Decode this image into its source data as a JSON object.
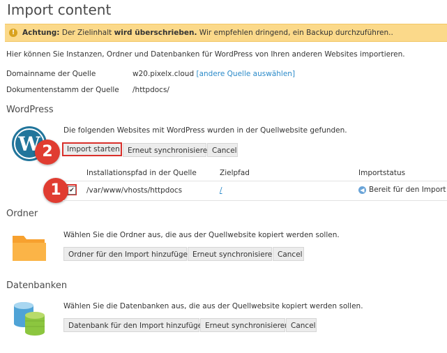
{
  "page": {
    "title": "Import content"
  },
  "warning": {
    "prefix": "Achtung:",
    "text_before": " Der Zielinhalt ",
    "emphasis": "wird überschrieben.",
    "text_after": " Wir empfehlen dringend, ein Backup durchzuführen.."
  },
  "intro": "Hier können Sie Instanzen, Ordner und Datenbanken für WordPress von Ihren anderen Websites importieren.",
  "source": {
    "domain_label": "Domainname der Quelle",
    "domain_value": "w20.pixelx.cloud",
    "change_link": "[andere Quelle auswählen]",
    "docroot_label": "Dokumentenstamm der Quelle",
    "docroot_value": "/httpdocs/"
  },
  "wordpress": {
    "heading": "WordPress",
    "description": "Die folgenden Websites mit WordPress wurden in der Quellwebsite gefunden.",
    "buttons": {
      "import": "Import starten",
      "sync": "Erneut synchronisieren",
      "cancel": "Cancel"
    },
    "table": {
      "headers": [
        "Installationspfad in der Quelle",
        "Zielpfad",
        "Importstatus"
      ],
      "rows": [
        {
          "checked": true,
          "path": "/var/www/vhosts/httpdocs",
          "target": "/",
          "status": "Bereit für den Import"
        }
      ]
    }
  },
  "folders": {
    "heading": "Ordner",
    "description": "Wählen Sie die Ordner aus, die aus der Quellwebsite kopiert werden sollen.",
    "buttons": {
      "add": "Ordner für den Import hinzufügen",
      "sync": "Erneut synchronisieren",
      "cancel": "Cancel"
    }
  },
  "databases": {
    "heading": "Datenbanken",
    "description": "Wählen Sie die Datenbanken aus, die aus der Quellwebsite kopiert werden sollen.",
    "buttons": {
      "add": "Datenbank für den Import hinzufügen",
      "sync": "Erneut synchronisieren",
      "cancel": "Cancel"
    }
  },
  "callouts": [
    "1",
    "2"
  ],
  "icons": {
    "wordpress": "wordpress-logo-icon",
    "folder": "folder-icon",
    "database": "database-icon",
    "status": "arrow-left-circle-icon"
  },
  "colors": {
    "warning_bg": "#fbd98a",
    "callout": "#e03c31",
    "link": "#2a8ac9",
    "button_bg": "#ececec"
  }
}
